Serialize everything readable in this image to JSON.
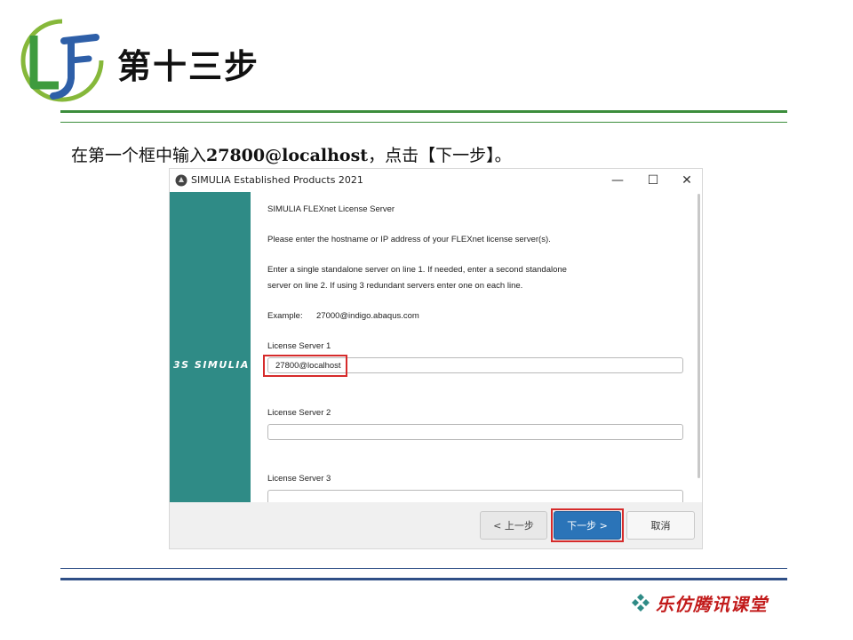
{
  "slide": {
    "title": "第十三步",
    "instruction_prefix": "在第一个框中输入",
    "instruction_value": "27800@localhost",
    "instruction_suffix": "，点击【下一步】。",
    "footer_brand": "乐仿腾讯课堂"
  },
  "window": {
    "title": "SIMULIA Established Products 2021",
    "minimize_glyph": "—",
    "maximize_glyph": "☐",
    "close_glyph": "✕",
    "brand": "3S SIMULIA"
  },
  "content": {
    "heading": "SIMULIA FLEXnet License Server",
    "line1": "Please enter the hostname or IP address of your FLEXnet license server(s).",
    "line2": "Enter a single standalone server on line 1.  If needed, enter a second standalone",
    "line3": "server on line 2.  If using 3 redundant servers enter one on each line.",
    "example_label": "Example:",
    "example_value": "27000@indigo.abaqus.com",
    "server1_label": "License Server 1",
    "server1_value": "27800@localhost",
    "server2_label": "License Server 2",
    "server2_value": "",
    "server3_label": "License Server 3",
    "server3_value": ""
  },
  "buttons": {
    "back": "< 上一步",
    "next": "下一步 >",
    "cancel": "取消"
  },
  "colors": {
    "sidebar": "#2f8b86",
    "next_button": "#2b74b8",
    "highlight": "#d62b2b",
    "header_rule": "#3c8d3c",
    "footer_rule": "#2f4f86",
    "footer_brand": "#c21b1b"
  }
}
